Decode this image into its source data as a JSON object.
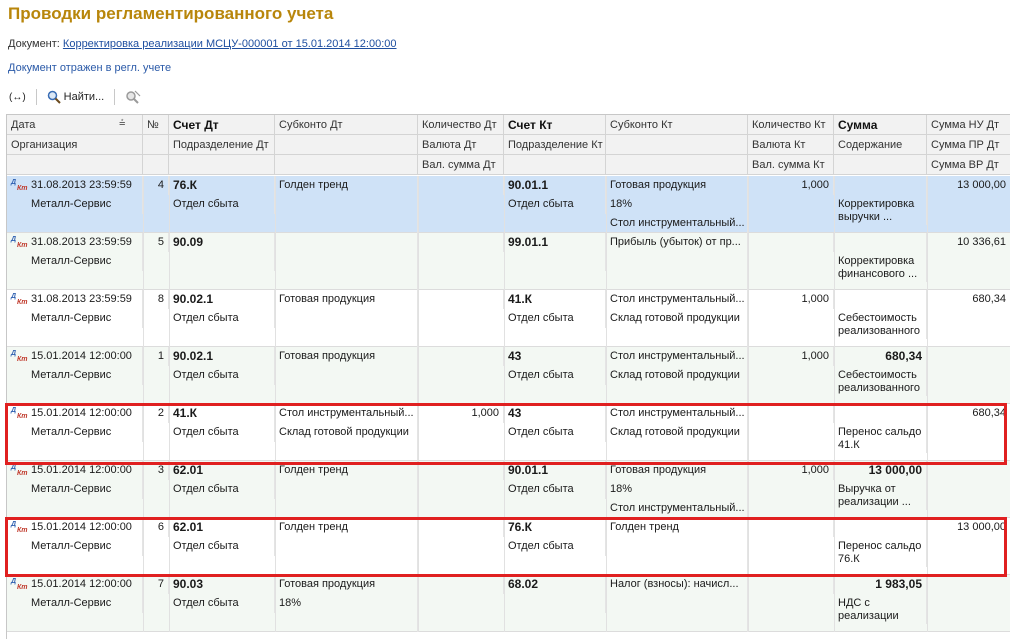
{
  "title": "Проводки регламентированного учета",
  "document": {
    "label": "Документ:",
    "link": "Корректировка реализации МСЦУ-000001 от 15.01.2014 12:00:00"
  },
  "reflected": "Документ отражен в регл. учете",
  "toolbar": {
    "find_label": "Найти..."
  },
  "header": {
    "row1": [
      "Дата",
      "№",
      "Счет Дт",
      "Субконто Дт",
      "Количество Дт",
      "Счет Кт",
      "Субконто Кт",
      "Количество Кт",
      "Сумма",
      "Сумма НУ Дт"
    ],
    "row2": [
      "Организация",
      "",
      "Подразделение Дт",
      "",
      "Валюта Дт",
      "Подразделение Кт",
      "",
      "Валюта Кт",
      "Содержание",
      "Сумма ПР Дт"
    ],
    "row3": [
      "",
      "",
      "",
      "",
      "Вал. сумма Дт",
      "",
      "",
      "Вал. сумма Кт",
      "",
      "Сумма ВР Дт"
    ]
  },
  "rows": [
    {
      "date": "31.08.2013 23:59:59",
      "org": "Металл-Сервис",
      "num": "4",
      "acc_dt": "76.К",
      "div_dt": "Отдел сбыта",
      "sub_dt": [
        "Голден тренд",
        "",
        ""
      ],
      "qty_dt": "",
      "acc_kt": "90.01.1",
      "div_kt": "Отдел сбыта",
      "sub_kt": [
        "Готовая продукция",
        "18%",
        "Стол инструментальный..."
      ],
      "qty_kt": "1,000",
      "sum": "",
      "content": "Корректировка выручки ...",
      "nu": "13 000,00",
      "selected": true
    },
    {
      "date": "31.08.2013 23:59:59",
      "org": "Металл-Сервис",
      "num": "5",
      "acc_dt": "90.09",
      "div_dt": "",
      "sub_dt": [
        "",
        "",
        ""
      ],
      "qty_dt": "",
      "acc_kt": "99.01.1",
      "div_kt": "",
      "sub_kt": [
        "Прибыль (убыток) от пр...",
        "",
        ""
      ],
      "qty_kt": "",
      "sum": "",
      "content": "Корректировка финансового ...",
      "nu": "10 336,61",
      "selected": false
    },
    {
      "date": "31.08.2013 23:59:59",
      "org": "Металл-Сервис",
      "num": "8",
      "acc_dt": "90.02.1",
      "div_dt": "Отдел сбыта",
      "sub_dt": [
        "Готовая продукция",
        "",
        ""
      ],
      "qty_dt": "",
      "acc_kt": "41.К",
      "div_kt": "Отдел сбыта",
      "sub_kt": [
        "Стол инструментальный...",
        "Склад готовой продукции",
        ""
      ],
      "qty_kt": "1,000",
      "sum": "",
      "content": "Себестоимость реализованного",
      "nu": "680,34",
      "selected": false
    },
    {
      "date": "15.01.2014 12:00:00",
      "org": "Металл-Сервис",
      "num": "1",
      "acc_dt": "90.02.1",
      "div_dt": "Отдел сбыта",
      "sub_dt": [
        "Готовая продукция",
        "",
        ""
      ],
      "qty_dt": "",
      "acc_kt": "43",
      "div_kt": "Отдел сбыта",
      "sub_kt": [
        "Стол инструментальный...",
        "Склад готовой продукции",
        ""
      ],
      "qty_kt": "1,000",
      "sum": "680,34",
      "content": "Себестоимость реализованного",
      "nu": "",
      "selected": false
    },
    {
      "date": "15.01.2014 12:00:00",
      "org": "Металл-Сервис",
      "num": "2",
      "acc_dt": "41.К",
      "div_dt": "Отдел сбыта",
      "sub_dt": [
        "Стол инструментальный...",
        "Склад готовой продукции",
        ""
      ],
      "qty_dt": "1,000",
      "acc_kt": "43",
      "div_kt": "Отдел сбыта",
      "sub_kt": [
        "Стол инструментальный...",
        "Склад готовой продукции",
        ""
      ],
      "qty_kt": "",
      "sum": "",
      "content": "Перенос сальдо 41.К",
      "nu": "680,34",
      "selected": false
    },
    {
      "date": "15.01.2014 12:00:00",
      "org": "Металл-Сервис",
      "num": "3",
      "acc_dt": "62.01",
      "div_dt": "Отдел сбыта",
      "sub_dt": [
        "Голден тренд",
        "",
        ""
      ],
      "qty_dt": "",
      "acc_kt": "90.01.1",
      "div_kt": "Отдел сбыта",
      "sub_kt": [
        "Готовая продукция",
        "18%",
        "Стол инструментальный..."
      ],
      "qty_kt": "1,000",
      "sum": "13 000,00",
      "content": "Выручка от реализации ...",
      "nu": "",
      "selected": false
    },
    {
      "date": "15.01.2014 12:00:00",
      "org": "Металл-Сервис",
      "num": "6",
      "acc_dt": "62.01",
      "div_dt": "Отдел сбыта",
      "sub_dt": [
        "Голден тренд",
        "",
        ""
      ],
      "qty_dt": "",
      "acc_kt": "76.К",
      "div_kt": "Отдел сбыта",
      "sub_kt": [
        "Голден тренд",
        "",
        ""
      ],
      "qty_kt": "",
      "sum": "",
      "content": "Перенос сальдо 76.К",
      "nu": "13 000,00",
      "selected": false
    },
    {
      "date": "15.01.2014 12:00:00",
      "org": "Металл-Сервис",
      "num": "7",
      "acc_dt": "90.03",
      "div_dt": "Отдел сбыта",
      "sub_dt": [
        "Готовая продукция",
        "18%",
        ""
      ],
      "qty_dt": "",
      "acc_kt": "68.02",
      "div_kt": "",
      "sub_kt": [
        "Налог (взносы): начисл...",
        "",
        ""
      ],
      "qty_kt": "",
      "sum": "1 983,05",
      "content": "НДС с реализации",
      "nu": "",
      "selected": false
    }
  ]
}
